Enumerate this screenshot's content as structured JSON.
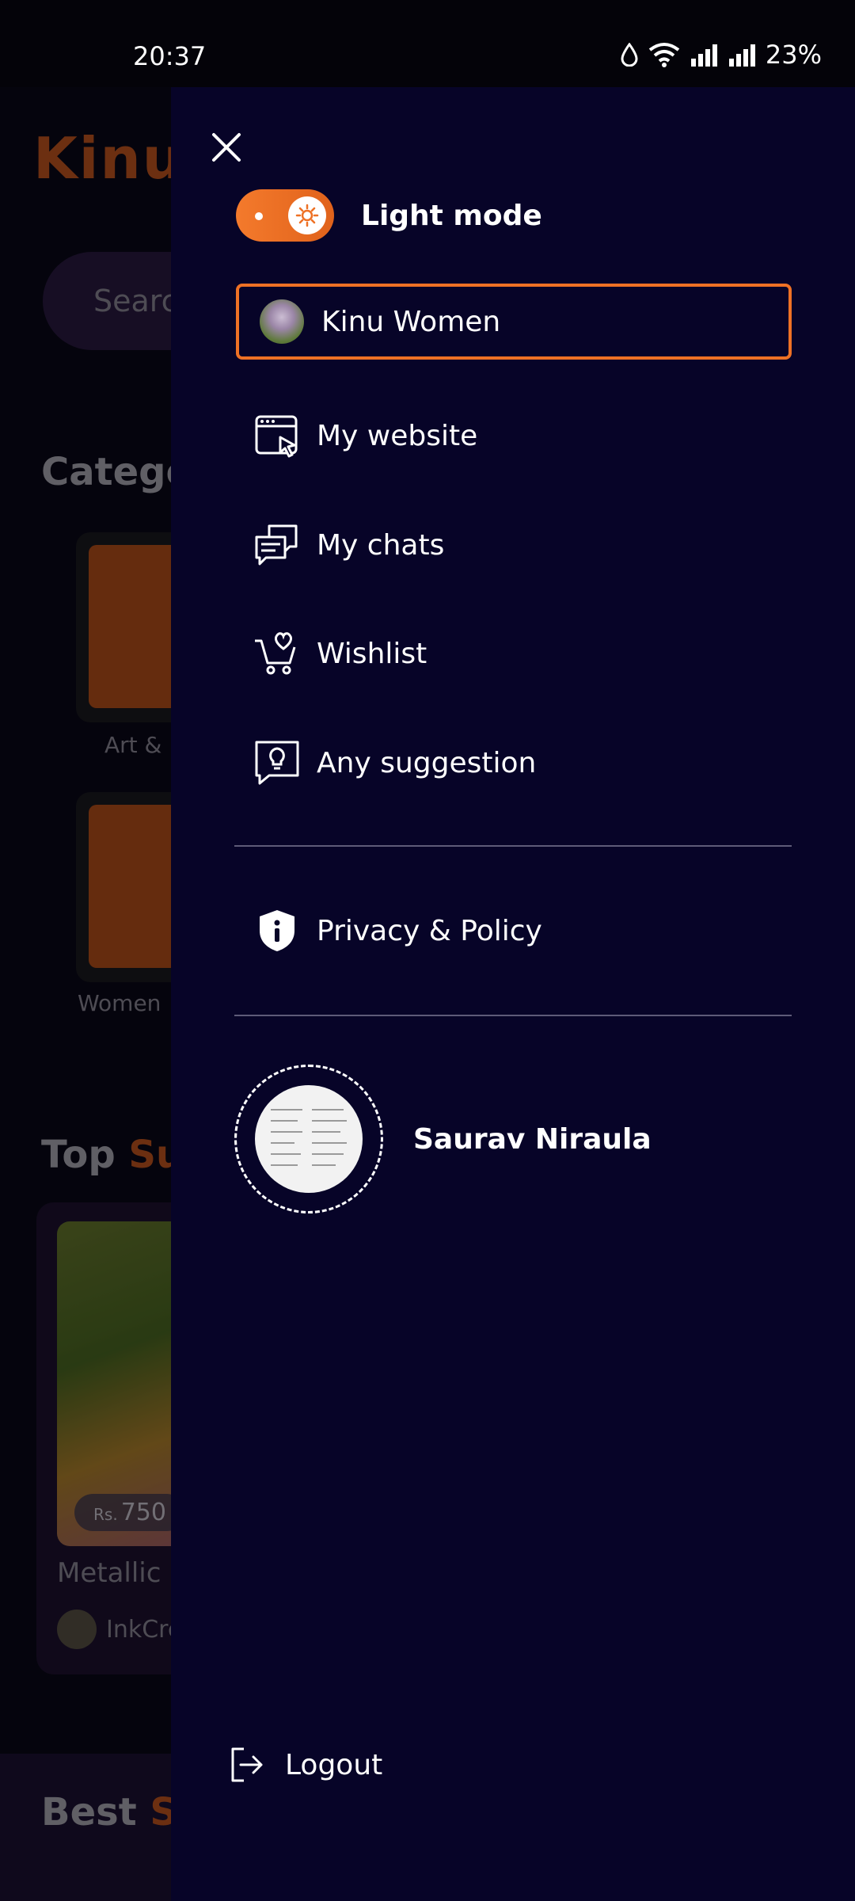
{
  "status_bar": {
    "time": "20:37",
    "battery": "23%",
    "icons": [
      "water-drop-icon",
      "wifi-icon",
      "signal-icon",
      "signal-icon"
    ]
  },
  "background": {
    "logo": "Kinu",
    "search_placeholder": "Searc",
    "categories_heading": "Catego",
    "category_labels": [
      "Art &",
      "Women"
    ],
    "top_heading_plain": "Top ",
    "top_heading_accent": "Su",
    "product": {
      "price_currency": "Rs.",
      "price": "750",
      "title": "Metallic",
      "seller": "InkCre"
    },
    "best_heading_plain": "Best ",
    "best_heading_accent": "S"
  },
  "drawer": {
    "theme_toggle_label": "Light mode",
    "account_name": "Kinu Women",
    "menu": [
      {
        "label": "My website",
        "icon": "website-cursor-icon"
      },
      {
        "label": "My chats",
        "icon": "chat-bubbles-icon"
      },
      {
        "label": "Wishlist",
        "icon": "cart-heart-icon"
      },
      {
        "label": "Any suggestion",
        "icon": "lightbulb-bubble-icon"
      }
    ],
    "privacy_label": "Privacy & Policy",
    "profile_name": "Saurav Niraula",
    "logout_label": "Logout"
  },
  "colors": {
    "accent": "#ee7125",
    "drawer_bg": "#070428",
    "divider": "#5e5b78"
  }
}
